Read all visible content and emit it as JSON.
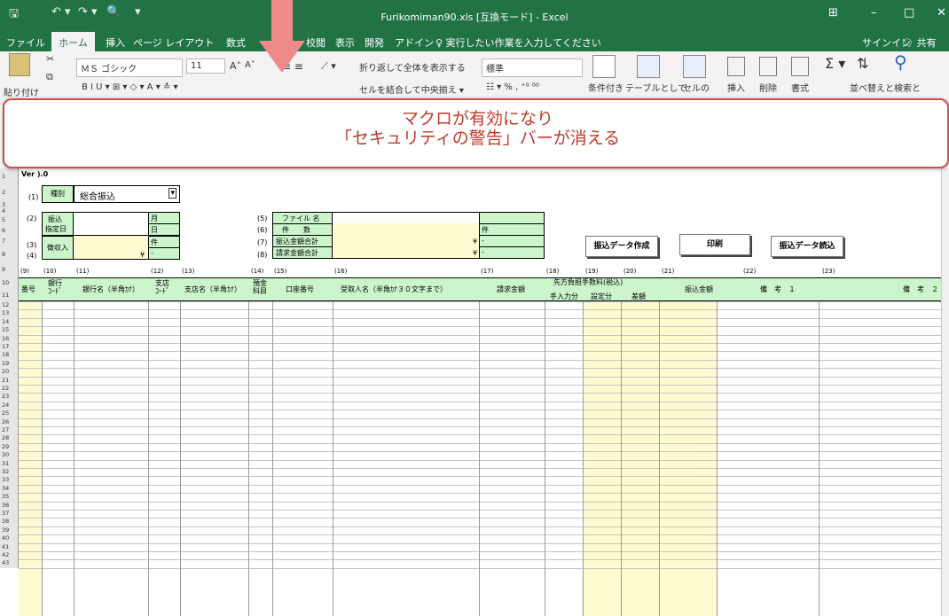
{
  "window": {
    "title": "Furikomiman90.xls [互換モード] - Excel",
    "qat": {
      "save": "🖫",
      "undo": "↶ ▾",
      "redo": "↷ ▾",
      "preview": "🔍",
      "more": "▾"
    },
    "controls": {
      "ribbon_display": "⊞",
      "minimize": "–",
      "maximize": "□",
      "close": "✕"
    }
  },
  "menu": {
    "tabs": [
      "ファイル",
      "ホーム",
      "挿入",
      "ページ レイアウト",
      "数式",
      "",
      "校閲",
      "表示",
      "開発",
      "アドイン"
    ],
    "tell_me": "♀ 実行したい作業を入力してください",
    "signin": "サインイン",
    "share": "🗨 共有"
  },
  "ribbon": {
    "paste": "貼り付け",
    "font_name": "ＭＳ ゴシック",
    "font_size": "11",
    "grow": "A˄",
    "shrink": "A˅",
    "format_row": "B  I  U ▾  ⊞ ▾  ◇ ▾  A ▾  ≛ ▾",
    "wrap": "折り返して全体を表示する",
    "merge": "セルを結合して中央揃え ▾",
    "number_format": "標準",
    "number_row": "☷ ▾  %  ,  ⁺⁰ ⁰⁰",
    "conditional": "条件付き",
    "table": "テーブルとして",
    "cell_style": "セルの",
    "insert": "挿入",
    "delete": "削除",
    "format": "書式",
    "sort": "並べ替えと",
    "find": "検索と"
  },
  "overlay": {
    "line1": "マクロが有効になり",
    "line2": "「セキュリティの警告」バーが消える",
    "arrow_color": "#ee8a8a"
  },
  "sheet": {
    "version": "Ver ).0",
    "row1": {
      "num1": "(1)",
      "label": "種別",
      "value": "総合振込"
    },
    "num2": "(2)",
    "furikomi": "振込",
    "shitei": "指定日",
    "tsuki": "月",
    "hi": "日",
    "num3": "(3)",
    "num4": "(4)",
    "choshu": "徴収入",
    "ken": "件",
    "yen_mark": "¥",
    "dash": "-",
    "file_group": {
      "nums": [
        "(5)",
        "(6)",
        "(7)",
        "(8)"
      ],
      "labels": [
        "ファイル 名",
        "件　　数",
        "振込金額合計",
        "請求金額合計"
      ],
      "ken": "件",
      "yen": "¥",
      "dash": "-"
    },
    "buttons": {
      "create": "振込データ作成",
      "print": "印刷",
      "read": "振込データ読込"
    },
    "col_nums": [
      "(9)",
      "(10)",
      "(11)",
      "(12)",
      "(13)",
      "(14)",
      "(15)",
      "(16)",
      "(17)",
      "(18)",
      "(19)",
      "(20)",
      "(21)",
      "(22)",
      "(23)"
    ],
    "headers": {
      "bango": "番号",
      "ginko_code": "銀行\nｺｰﾄﾞ",
      "ginko_name": "銀行名（半角ｶﾅ）",
      "shiten_code": "支店\nｺｰﾄﾞ",
      "shiten_name": "支店名（半角ｶﾅ）",
      "yokin": "預金\n科目",
      "koza": "口座番号",
      "uketori": "受取人名（半角ｶﾅ３０文字まで）",
      "seikyu": "請求金額",
      "tesuryo_title": "先方負担手数料(税込)",
      "tenyuryoku": "手入力分",
      "setei": "設定分",
      "sagaku": "差額",
      "furikomi_kingaku": "振込金額",
      "biko1": "備　考　１",
      "biko2": "備　考　２"
    },
    "row_numbers": [
      "1",
      "2",
      "3",
      "4",
      "5",
      "6",
      "7",
      "8",
      "9",
      "10",
      "11",
      "12",
      "13",
      "14",
      "15",
      "16",
      "17",
      "18",
      "19",
      "20",
      "21",
      "22",
      "23",
      "24",
      "25",
      "26",
      "27",
      "28",
      "29",
      "30",
      "31",
      "32",
      "33",
      "34",
      "35",
      "36",
      "37",
      "38",
      "39",
      "40",
      "41",
      "42",
      "43"
    ]
  }
}
